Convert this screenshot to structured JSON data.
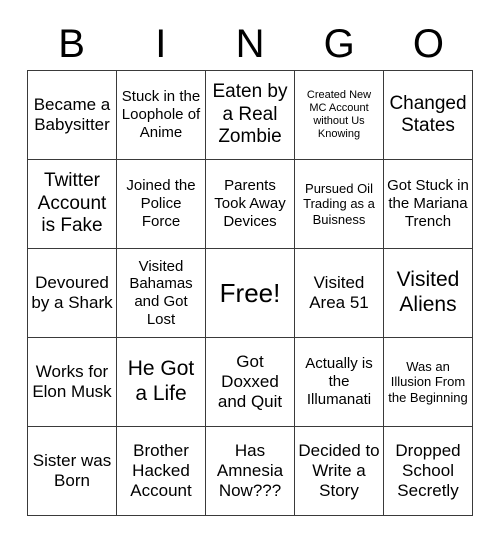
{
  "card": {
    "title_letters": [
      "B",
      "I",
      "N",
      "G",
      "O"
    ],
    "colors": {
      "background": "#ffffff",
      "text": "#000000",
      "border": "#3a3a3a"
    },
    "grid": {
      "rows": 5,
      "columns": 5,
      "free_space_index": 12
    },
    "cells": [
      {
        "text": "Became a Babysitter",
        "size": "fs-lg",
        "free": false
      },
      {
        "text": "Stuck in the Loophole of Anime",
        "size": "fs-md",
        "free": false
      },
      {
        "text": "Eaten by a Real Zombie",
        "size": "fs-xl",
        "free": false
      },
      {
        "text": "Created New MC Account without Us Knowing",
        "size": "fs-xs",
        "free": false
      },
      {
        "text": "Changed States",
        "size": "fs-xl",
        "free": false
      },
      {
        "text": "Twitter Account is Fake",
        "size": "fs-xl",
        "free": false
      },
      {
        "text": "Joined the Police Force",
        "size": "fs-md",
        "free": false
      },
      {
        "text": "Parents Took Away Devices",
        "size": "fs-md",
        "free": false
      },
      {
        "text": "Pursued Oil Trading as a Buisness",
        "size": "fs-sm",
        "free": false
      },
      {
        "text": "Got Stuck in the Mariana Trench",
        "size": "fs-md",
        "free": false
      },
      {
        "text": "Devoured by a Shark",
        "size": "fs-lg",
        "free": false
      },
      {
        "text": "Visited Bahamas and Got Lost",
        "size": "fs-md",
        "free": false
      },
      {
        "text": "Free!",
        "size": "fs-free",
        "free": true
      },
      {
        "text": "Visited Area 51",
        "size": "fs-lg",
        "free": false
      },
      {
        "text": "Visited Aliens",
        "size": "fs-xxl",
        "free": false
      },
      {
        "text": "Works for Elon Musk",
        "size": "fs-lg",
        "free": false
      },
      {
        "text": "He Got a Life",
        "size": "fs-xxl",
        "free": false
      },
      {
        "text": "Got Doxxed and Quit",
        "size": "fs-lg",
        "free": false
      },
      {
        "text": "Actually is the Illumanati",
        "size": "fs-md",
        "free": false
      },
      {
        "text": "Was an Illusion From the Beginning",
        "size": "fs-sm",
        "free": false
      },
      {
        "text": "Sister was Born",
        "size": "fs-lg",
        "free": false
      },
      {
        "text": "Brother Hacked Account",
        "size": "fs-lg",
        "free": false
      },
      {
        "text": "Has Amnesia Now???",
        "size": "fs-lg",
        "free": false
      },
      {
        "text": "Decided to Write a Story",
        "size": "fs-lg",
        "free": false
      },
      {
        "text": "Dropped School Secretly",
        "size": "fs-lg",
        "free": false
      }
    ]
  }
}
